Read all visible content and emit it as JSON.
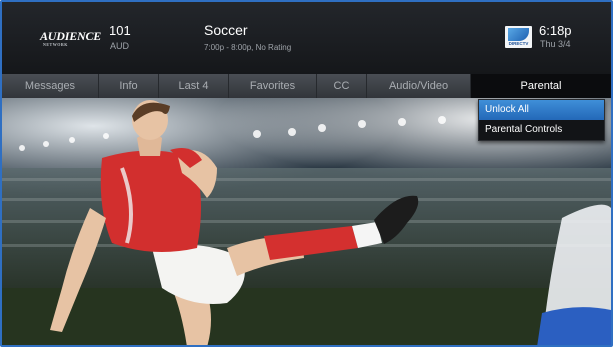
{
  "channel": {
    "logo_text": "AUDIENCE",
    "logo_subtext": "NETWORK",
    "number": "101",
    "call_sign": "AUD"
  },
  "program": {
    "title": "Soccer",
    "details": "7:00p - 8:00p, No Rating"
  },
  "provider": {
    "logo_text": "DIRECTV"
  },
  "clock": {
    "time": "6:18p",
    "date": "Thu 3/4"
  },
  "menu": {
    "items": [
      {
        "label": "Messages"
      },
      {
        "label": "Info"
      },
      {
        "label": "Last 4"
      },
      {
        "label": "Favorites"
      },
      {
        "label": "CC"
      },
      {
        "label": "Audio/Video"
      },
      {
        "label": "Parental"
      }
    ],
    "active_index": 6
  },
  "dropdown": {
    "items": [
      {
        "label": "Unlock All",
        "selected": true
      },
      {
        "label": "Parental Controls",
        "selected": false
      }
    ]
  },
  "colors": {
    "accent": "#2f6fc2",
    "selection": "#2f7fcd"
  }
}
